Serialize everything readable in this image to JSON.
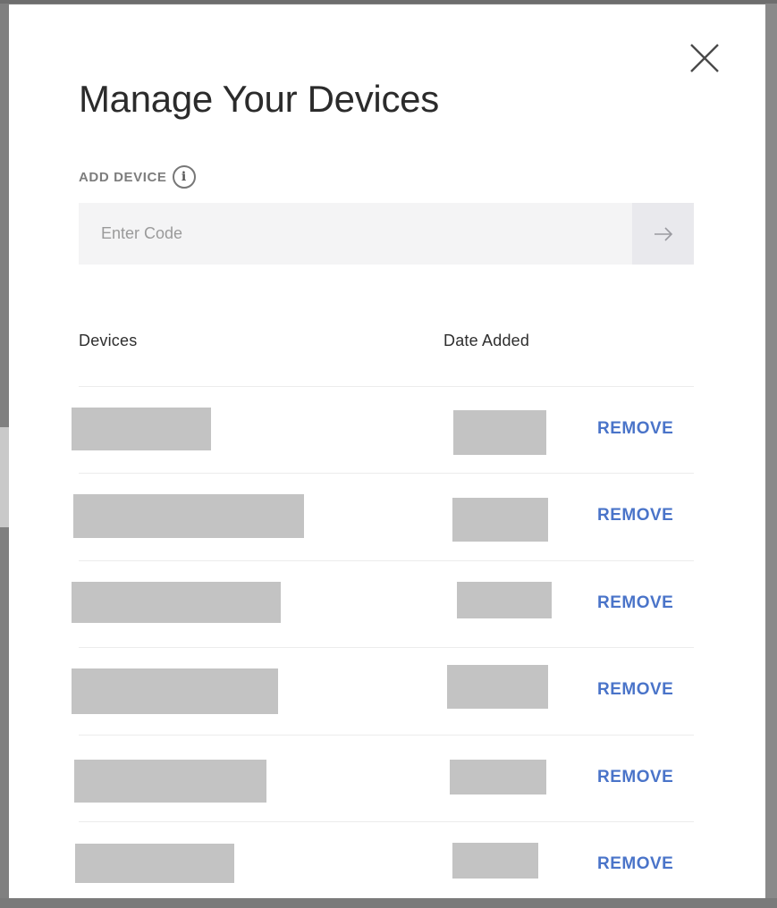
{
  "modal": {
    "title": "Manage Your Devices",
    "add_device": {
      "label": "ADD DEVICE",
      "info_glyph": "i",
      "placeholder": "Enter Code",
      "value": ""
    },
    "table": {
      "columns": [
        "Devices",
        "Date Added"
      ],
      "rows": [
        {
          "device": "",
          "date_added": "",
          "action": "REMOVE"
        },
        {
          "device": "",
          "date_added": "",
          "action": "REMOVE"
        },
        {
          "device": "",
          "date_added": "",
          "action": "REMOVE"
        },
        {
          "device": "",
          "date_added": "",
          "action": "REMOVE"
        },
        {
          "device": "",
          "date_added": "",
          "action": "REMOVE"
        },
        {
          "device": "",
          "date_added": "",
          "action": "REMOVE"
        }
      ]
    }
  },
  "icons": {
    "close": "close-icon",
    "info": "info-icon",
    "submit": "arrow-right-icon"
  },
  "colors": {
    "link": "#4a74c9",
    "redaction": "#c3c3c3",
    "input_bg": "#f4f4f5"
  }
}
